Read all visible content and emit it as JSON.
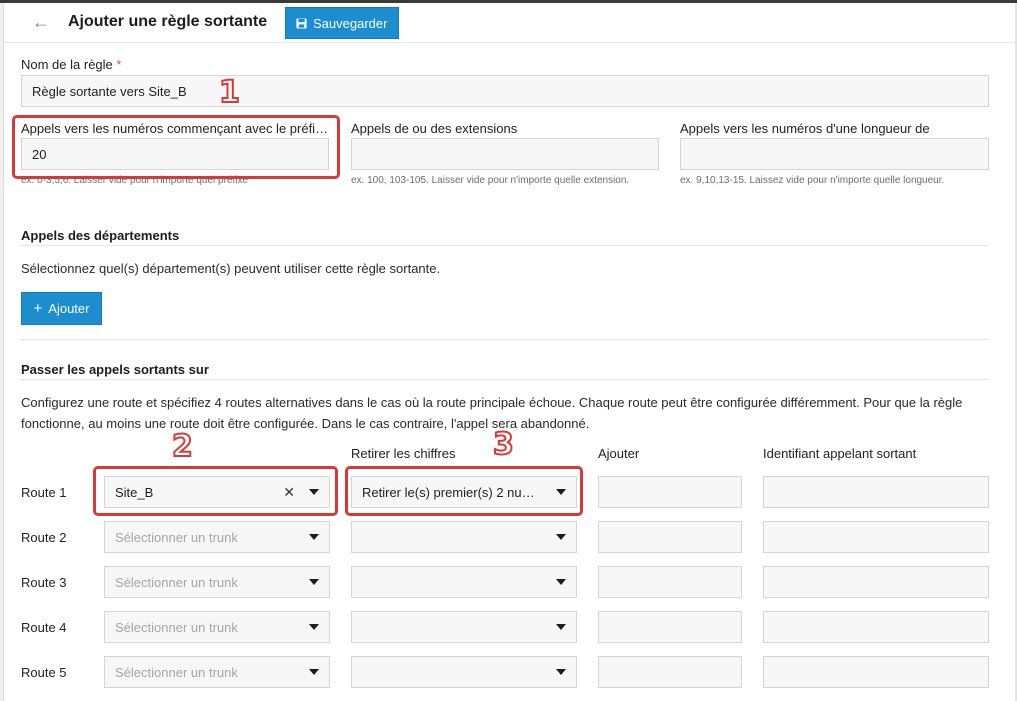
{
  "header": {
    "title": "Ajouter une règle sortante",
    "save_label": "Sauvegarder"
  },
  "rule_name": {
    "label": "Nom de la règle",
    "required_mark": "*",
    "value": "Règle sortante vers Site_B"
  },
  "filters": {
    "prefix": {
      "label": "Appels vers les numéros commençant avec le préfi…",
      "value": "20",
      "help": "ex. 0-3,5,6. Laisser vide pour n'importe quel préfixe"
    },
    "extensions": {
      "label": "Appels de ou des extensions",
      "value": "",
      "help": "ex. 100, 103-105. Laisser vide pour n'importe quelle extension."
    },
    "length": {
      "label": "Appels vers les numéros d'une longueur de",
      "value": "",
      "help": "ex. 9,10,13-15. Laissez vide pour n'importe quelle longueur."
    }
  },
  "departments": {
    "title": "Appels des départements",
    "description": "Sélectionnez quel(s) département(s) peuvent utiliser cette règle sortante.",
    "add_label": "Ajouter"
  },
  "routing": {
    "title": "Passer les appels sortants sur",
    "description": "Configurez une route et spécifiez 4 routes alternatives dans le cas où la route principale échoue. Chaque route peut être configurée différemment. Pour que la règle fonctionne, au moins une route doit être configurée. Dans le cas contraire, l'appel sera abandonné.",
    "columns": {
      "strip": "Retirer les chiffres",
      "prepend": "Ajouter",
      "caller_id": "Identifiant appelant sortant"
    },
    "routes": [
      {
        "label": "Route 1",
        "trunk": "Site_B",
        "trunk_placeholder": "",
        "strip": "Retirer le(s) premier(s) 2 nu…",
        "prepend": "",
        "caller_id": ""
      },
      {
        "label": "Route 2",
        "trunk": "",
        "trunk_placeholder": "Sélectionner un trunk",
        "strip": "",
        "prepend": "",
        "caller_id": ""
      },
      {
        "label": "Route 3",
        "trunk": "",
        "trunk_placeholder": "Sélectionner un trunk",
        "strip": "",
        "prepend": "",
        "caller_id": ""
      },
      {
        "label": "Route 4",
        "trunk": "",
        "trunk_placeholder": "Sélectionner un trunk",
        "strip": "",
        "prepend": "",
        "caller_id": ""
      },
      {
        "label": "Route 5",
        "trunk": "",
        "trunk_placeholder": "Sélectionner un trunk",
        "strip": "",
        "prepend": "",
        "caller_id": ""
      }
    ]
  },
  "annotations": {
    "one": "1",
    "two": "2",
    "three": "3",
    "color": "#d9383a"
  },
  "colors": {
    "accent": "#1c8ed0",
    "input_bg": "#f7f7f7",
    "required": "#d9534f"
  },
  "icons": {
    "back": "arrow-left-icon",
    "save": "floppy-disk-icon",
    "add": "plus-icon",
    "clear": "close-icon",
    "dropdown": "caret-down-icon"
  }
}
